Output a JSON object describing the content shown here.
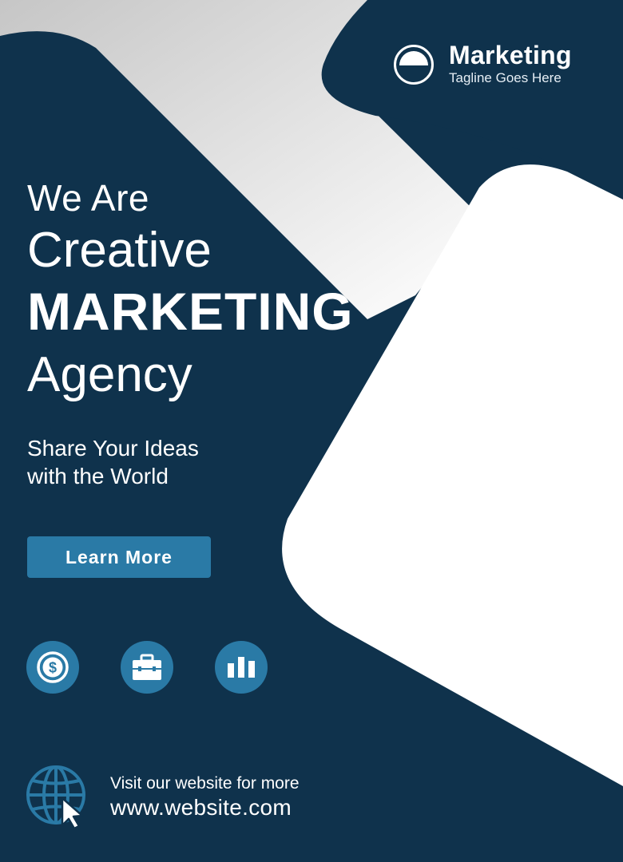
{
  "brand": {
    "name": "Marketing",
    "tagline": "Tagline Goes Here"
  },
  "headline": {
    "line1": "We Are",
    "line2": "Creative",
    "line3": "MARKETING",
    "line4": "Agency"
  },
  "subheading": {
    "line1": "Share Your Ideas",
    "line2": "with the World"
  },
  "cta": {
    "label": "Learn More"
  },
  "feature_icons": [
    "dollar-icon",
    "briefcase-icon",
    "bar-chart-icon"
  ],
  "footer": {
    "visit_text": "Visit our website for more",
    "website": "www.website.com"
  },
  "colors": {
    "navy": "#0f324c",
    "accent": "#2a7aa6",
    "white": "#ffffff",
    "gray_gradient_start": "#c9c9c9"
  }
}
